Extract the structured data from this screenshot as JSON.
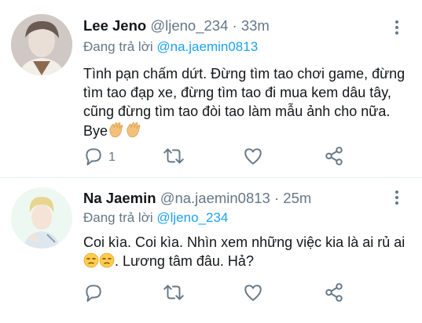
{
  "tweets": [
    {
      "display_name": "Lee Jeno",
      "handle": "@ljeno_234",
      "separator": "·",
      "time": "33m",
      "reply_prefix": "Đang trả lời",
      "reply_to": "@na.jaemin0813",
      "text_main": "Tình pạn chấm dứt. Đừng tìm tao chơi game, đừng tìm tao đạp xe, đừng tìm tao đi  mua kem dâu tây, cũng đừng tìm tao đòi tao làm mẫu ảnh cho nữa. Bye",
      "emoji": [
        "waving-hand",
        "waving-hand"
      ],
      "reply_count": "1",
      "avatar_icon": "user-avatar"
    },
    {
      "display_name": "Na Jaemin",
      "handle": "@na.jaemin0813",
      "separator": "·",
      "time": "25m",
      "reply_prefix": "Đang trả lời",
      "reply_to": "@ljeno_234",
      "text_part1": "Coi kìa. Coi kìa. Nhìn xem những việc kia là ai rủ ai",
      "text_part2": ". Lương tâm đâu. Hả?",
      "emoji": [
        "unamused-face",
        "unamused-face"
      ],
      "reply_count": "",
      "avatar_icon": "user-avatar"
    }
  ],
  "colors": {
    "accent": "#1da1f2",
    "secondary_text": "#657786",
    "primary_text": "#14171a",
    "divider": "#e6ecf0"
  },
  "icons": [
    "reply-icon",
    "retweet-icon",
    "like-icon",
    "share-icon",
    "more-options-icon"
  ]
}
